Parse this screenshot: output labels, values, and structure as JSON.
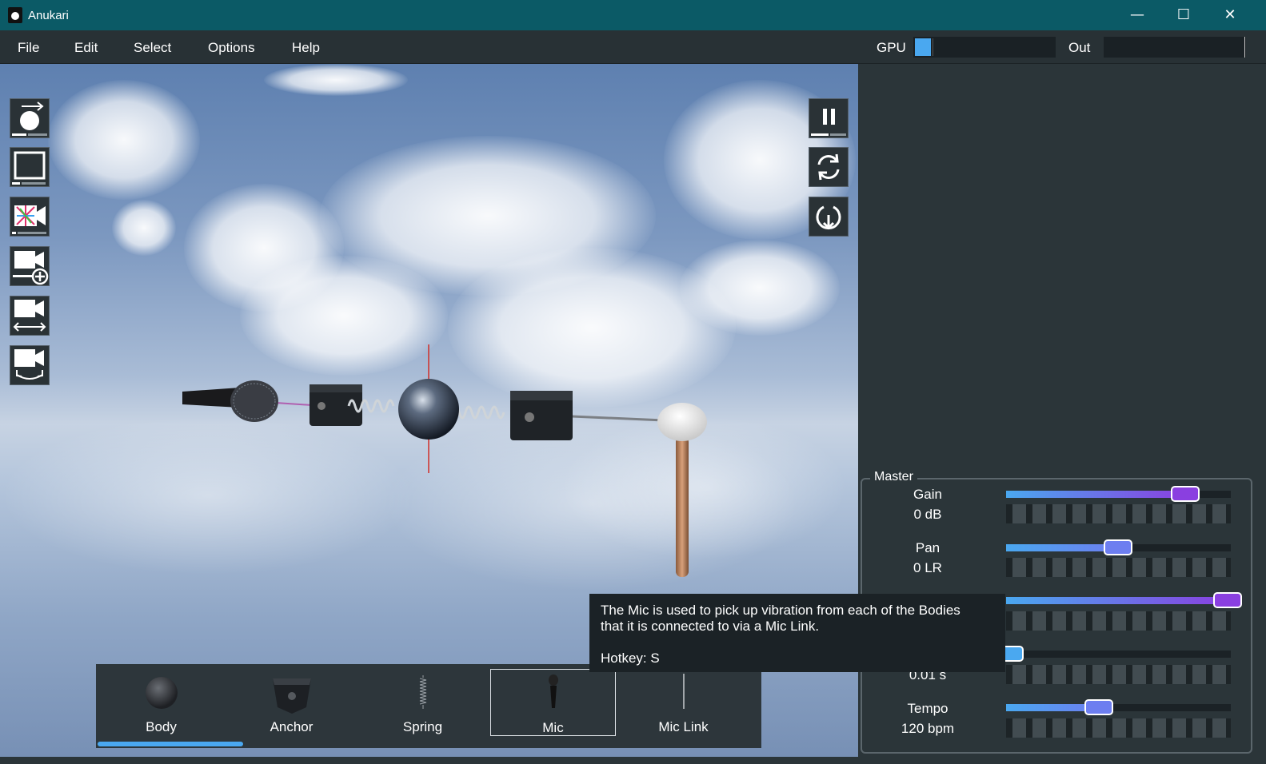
{
  "window": {
    "title": "Anukari",
    "minimize_icon": "minimize-icon",
    "maximize_icon": "maximize-icon",
    "close_icon": "close-icon"
  },
  "menu": {
    "items": [
      "File",
      "Edit",
      "Select",
      "Options",
      "Help"
    ]
  },
  "meters": {
    "gpu_label": "GPU",
    "out_label": "Out"
  },
  "toolbar_left": [
    "add-body-icon",
    "select-box-icon",
    "camera-color-icon",
    "camera-add-icon",
    "camera-pan-icon",
    "camera-rotate-icon"
  ],
  "toolbar_right": [
    "pause-icon",
    "reset-icon",
    "reload-icon"
  ],
  "palette": {
    "items": [
      {
        "label": "Body",
        "icon": "body-sphere-icon"
      },
      {
        "label": "Anchor",
        "icon": "anchor-icon"
      },
      {
        "label": "Spring",
        "icon": "spring-icon"
      },
      {
        "label": "Mic",
        "icon": "mic-icon"
      },
      {
        "label": "Mic Link",
        "icon": "mic-link-icon"
      }
    ],
    "selected": "Mic"
  },
  "master": {
    "title": "Master",
    "params": [
      {
        "name": "Gain",
        "value": "0 dB",
        "level": 0.82
      },
      {
        "name": "Pan",
        "value": "0 LR",
        "level": 0.5
      },
      {
        "name": "",
        "value": "",
        "level": 1.0
      },
      {
        "name": "",
        "value": "0.01 s",
        "level": 0.03
      },
      {
        "name": "Tempo",
        "value": "120 bpm",
        "level": 0.42
      }
    ]
  },
  "tooltip": {
    "line1": "The Mic is used to pick up vibration from each of the Bodies",
    "line2": "that it is connected to via a Mic Link.",
    "hotkey": "Hotkey: S"
  },
  "colors": {
    "titlebar": "#0b5a66",
    "slider_blue": "#4aa8f0",
    "slider_purple": "#8a3fe0",
    "thumb_blue": "#6d7ef0"
  }
}
